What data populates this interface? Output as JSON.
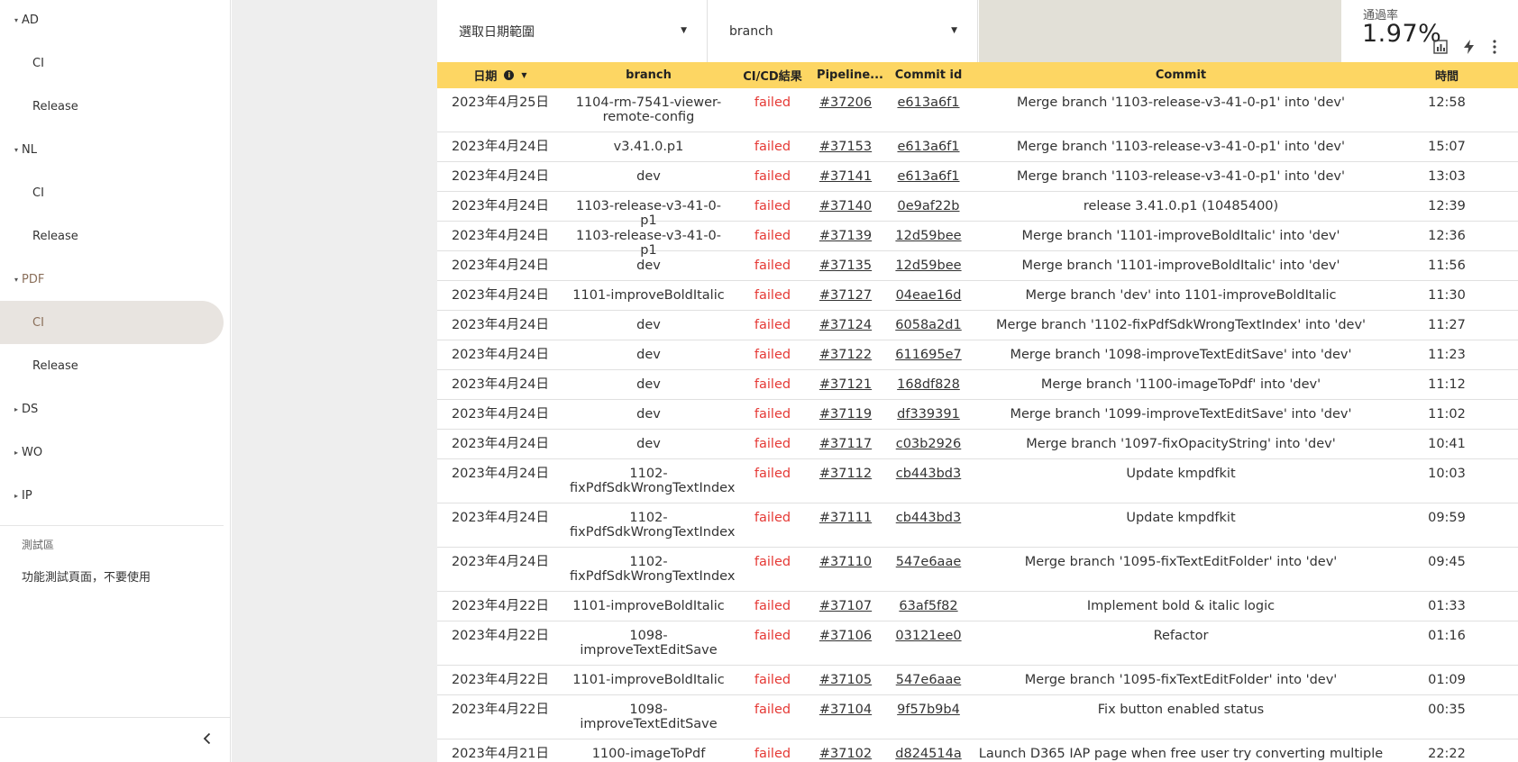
{
  "sidebar": {
    "groups": [
      {
        "label": "AD",
        "caret": "▾",
        "items": [
          "CI",
          "Release"
        ]
      },
      {
        "label": "NL",
        "caret": "▾",
        "items": [
          "CI",
          "Release"
        ]
      },
      {
        "label": "PDF",
        "caret": "▾",
        "items": [
          "CI",
          "Release"
        ]
      },
      {
        "label": "DS",
        "caret": "▸"
      },
      {
        "label": "WO",
        "caret": "▸"
      },
      {
        "label": "IP",
        "caret": "▸"
      }
    ],
    "test_section_label": "測試區",
    "test_item": "功能測試頁面，不要使用",
    "collapse_icon": "chevron-left-icon",
    "selected_group": "PDF",
    "selected_item": "CI"
  },
  "filters": {
    "date_range": "選取日期範圍",
    "branch": "branch",
    "dropdown_icon": "caret-down-icon"
  },
  "pass_rate": {
    "label": "通過率",
    "value": "1.97%",
    "icons": [
      "chart-icon",
      "bolt-icon",
      "more-vert-icon"
    ]
  },
  "table": {
    "headers": {
      "date": "日期",
      "branch": "branch",
      "status": "CI/CD結果",
      "pipeline": "Pipeline...",
      "commit_id": "Commit id",
      "commit": "Commit",
      "time": "時間"
    },
    "rows": [
      {
        "date": "2023年4月25日",
        "branch": "1104-rm-7541-viewer-remote-config",
        "status": "failed",
        "pipeline": "#37206",
        "commit_id": "e613a6f1",
        "commit": "Merge branch '1103-release-v3-41-0-p1' into 'dev'",
        "time": "12:58"
      },
      {
        "date": "2023年4月24日",
        "branch": "v3.41.0.p1",
        "status": "failed",
        "pipeline": "#37153",
        "commit_id": "e613a6f1",
        "commit": "Merge branch '1103-release-v3-41-0-p1' into 'dev'",
        "time": "15:07"
      },
      {
        "date": "2023年4月24日",
        "branch": "dev",
        "status": "failed",
        "pipeline": "#37141",
        "commit_id": "e613a6f1",
        "commit": "Merge branch '1103-release-v3-41-0-p1' into 'dev'",
        "time": "13:03"
      },
      {
        "date": "2023年4月24日",
        "branch": "1103-release-v3-41-0-p1",
        "status": "failed",
        "pipeline": "#37140",
        "commit_id": "0e9af22b",
        "commit": "release 3.41.0.p1 (10485400)",
        "time": "12:39"
      },
      {
        "date": "2023年4月24日",
        "branch": "1103-release-v3-41-0-p1",
        "status": "failed",
        "pipeline": "#37139",
        "commit_id": "12d59bee",
        "commit": "Merge branch '1101-improveBoldItalic' into 'dev'",
        "time": "12:36"
      },
      {
        "date": "2023年4月24日",
        "branch": "dev",
        "status": "failed",
        "pipeline": "#37135",
        "commit_id": "12d59bee",
        "commit": "Merge branch '1101-improveBoldItalic' into 'dev'",
        "time": "11:56"
      },
      {
        "date": "2023年4月24日",
        "branch": "1101-improveBoldItalic",
        "status": "failed",
        "pipeline": "#37127",
        "commit_id": "04eae16d",
        "commit": "Merge branch 'dev' into 1101-improveBoldItalic",
        "time": "11:30"
      },
      {
        "date": "2023年4月24日",
        "branch": "dev",
        "status": "failed",
        "pipeline": "#37124",
        "commit_id": "6058a2d1",
        "commit": "Merge branch '1102-fixPdfSdkWrongTextIndex' into 'dev'",
        "time": "11:27"
      },
      {
        "date": "2023年4月24日",
        "branch": "dev",
        "status": "failed",
        "pipeline": "#37122",
        "commit_id": "611695e7",
        "commit": "Merge branch '1098-improveTextEditSave' into 'dev'",
        "time": "11:23"
      },
      {
        "date": "2023年4月24日",
        "branch": "dev",
        "status": "failed",
        "pipeline": "#37121",
        "commit_id": "168df828",
        "commit": "Merge branch '1100-imageToPdf' into 'dev'",
        "time": "11:12"
      },
      {
        "date": "2023年4月24日",
        "branch": "dev",
        "status": "failed",
        "pipeline": "#37119",
        "commit_id": "df339391",
        "commit": "Merge branch '1099-improveTextEditSave' into 'dev'",
        "time": "11:02"
      },
      {
        "date": "2023年4月24日",
        "branch": "dev",
        "status": "failed",
        "pipeline": "#37117",
        "commit_id": "c03b2926",
        "commit": "Merge branch '1097-fixOpacityString' into 'dev'",
        "time": "10:41"
      },
      {
        "date": "2023年4月24日",
        "branch": "1102-fixPdfSdkWrongTextIndex",
        "status": "failed",
        "pipeline": "#37112",
        "commit_id": "cb443bd3",
        "commit": "Update kmpdfkit",
        "time": "10:03"
      },
      {
        "date": "2023年4月24日",
        "branch": "1102-fixPdfSdkWrongTextIndex",
        "status": "failed",
        "pipeline": "#37111",
        "commit_id": "cb443bd3",
        "commit": "Update kmpdfkit",
        "time": "09:59"
      },
      {
        "date": "2023年4月24日",
        "branch": "1102-fixPdfSdkWrongTextIndex",
        "status": "failed",
        "pipeline": "#37110",
        "commit_id": "547e6aae",
        "commit": "Merge branch '1095-fixTextEditFolder' into 'dev'",
        "time": "09:45"
      },
      {
        "date": "2023年4月22日",
        "branch": "1101-improveBoldItalic",
        "status": "failed",
        "pipeline": "#37107",
        "commit_id": "63af5f82",
        "commit": "Implement bold & italic logic",
        "time": "01:33"
      },
      {
        "date": "2023年4月22日",
        "branch": "1098-improveTextEditSave",
        "status": "failed",
        "pipeline": "#37106",
        "commit_id": "03121ee0",
        "commit": "Refactor",
        "time": "01:16"
      },
      {
        "date": "2023年4月22日",
        "branch": "1101-improveBoldItalic",
        "status": "failed",
        "pipeline": "#37105",
        "commit_id": "547e6aae",
        "commit": "Merge branch '1095-fixTextEditFolder' into 'dev'",
        "time": "01:09"
      },
      {
        "date": "2023年4月22日",
        "branch": "1098-improveTextEditSave",
        "status": "failed",
        "pipeline": "#37104",
        "commit_id": "9f57b9b4",
        "commit": "Fix button enabled status",
        "time": "00:35"
      },
      {
        "date": "2023年4月21日",
        "branch": "1100-imageToPdf",
        "status": "failed",
        "pipeline": "#37102",
        "commit_id": "d824514a",
        "commit": "Launch D365 IAP page when free user try converting multiple",
        "time": "22:22"
      }
    ]
  }
}
